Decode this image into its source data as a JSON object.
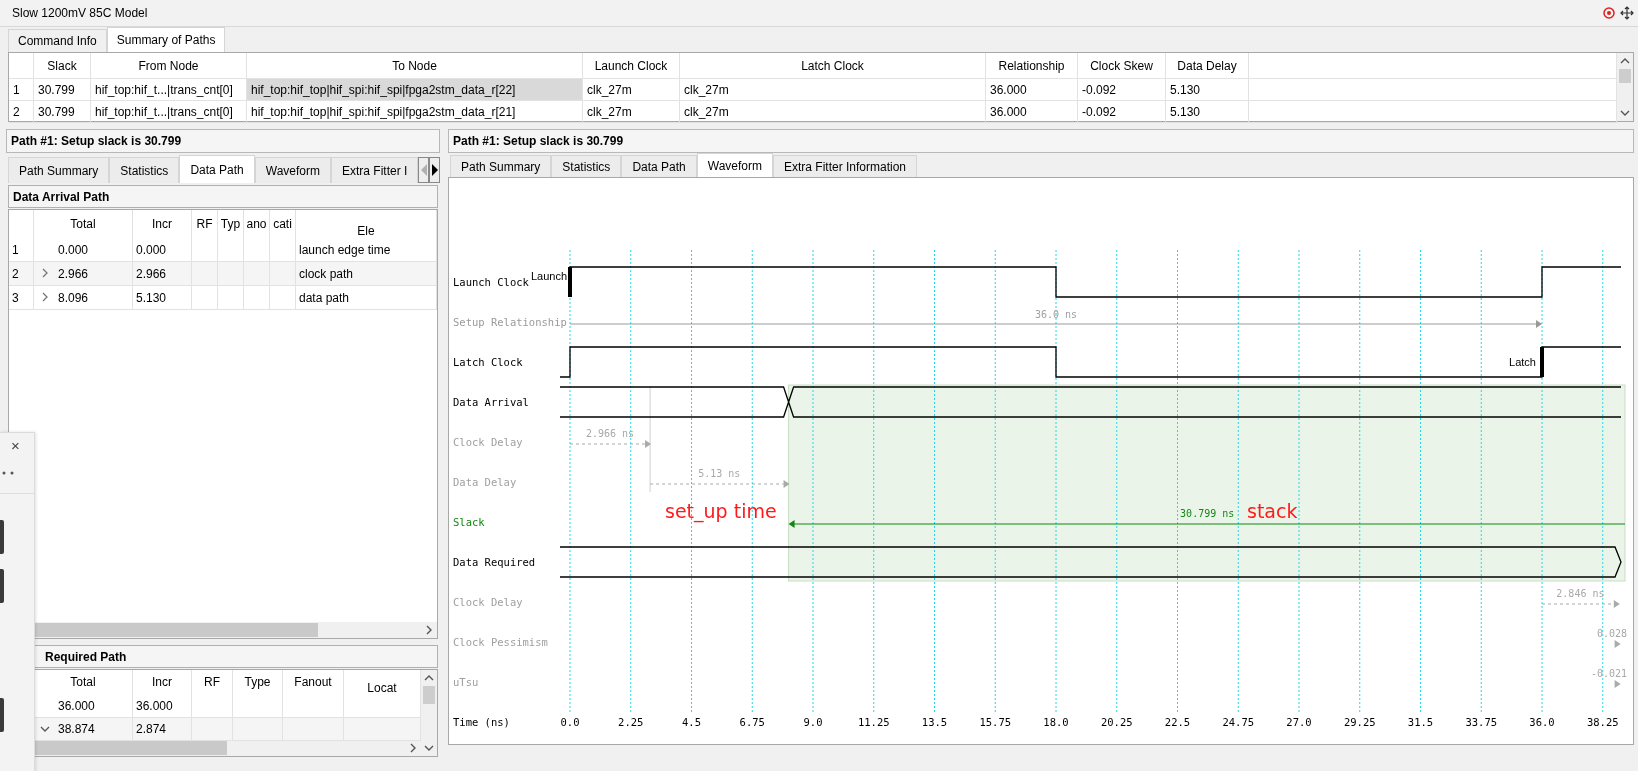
{
  "window": {
    "title": "Slow 1200mV 85C Model"
  },
  "tabs": [
    {
      "label": "Command Info",
      "selected": false
    },
    {
      "label": "Summary of Paths",
      "selected": true
    }
  ],
  "paths_table": {
    "columns": [
      "Slack",
      "From Node",
      "To Node",
      "Launch Clock",
      "Latch Clock",
      "Relationship",
      "Clock Skew",
      "Data Delay"
    ],
    "rows": [
      {
        "index": "1",
        "cells": [
          "30.799",
          "hif_top:hif_t...|trans_cnt[0]",
          "hif_top:hif_top|hif_spi:hif_spi|fpga2stm_data_r[22]",
          "clk_27m",
          "clk_27m",
          "36.000",
          "-0.092",
          "5.130"
        ],
        "selected": true
      },
      {
        "index": "2",
        "cells": [
          "30.799",
          "hif_top:hif_t...|trans_cnt[0]",
          "hif_top:hif_top|hif_spi:hif_spi|fpga2stm_data_r[21]",
          "clk_27m",
          "clk_27m",
          "36.000",
          "-0.092",
          "5.130"
        ],
        "selected": false
      }
    ]
  },
  "left_panel": {
    "title": "Path #1: Setup slack is 30.799",
    "tabs": [
      {
        "label": "Path Summary",
        "selected": false
      },
      {
        "label": "Statistics",
        "selected": false
      },
      {
        "label": "Data Path",
        "selected": true
      },
      {
        "label": "Waveform",
        "selected": false
      },
      {
        "label": "Extra Fitter I",
        "selected": false
      }
    ],
    "tab_scroll_buttons": [
      {
        "disabled": true
      },
      {
        "disabled": false
      }
    ],
    "arrival": {
      "title": "Data Arrival Path",
      "columns": [
        "Total",
        "Incr",
        "RF",
        "Typ",
        "ano",
        "cati",
        "Ele"
      ],
      "rows": [
        {
          "index": "1",
          "total": "0.000",
          "incr": "0.000",
          "element": "launch edge time"
        },
        {
          "index": "2",
          "total": "2.966",
          "incr": "2.966",
          "element": "clock path",
          "expanded": false
        },
        {
          "index": "3",
          "total": "8.096",
          "incr": "5.130",
          "element": "data path",
          "expanded": false
        }
      ]
    },
    "required": {
      "title": "Required Path",
      "columns": [
        "Total",
        "Incr",
        "RF",
        "Type",
        "Fanout",
        "Locat"
      ],
      "rows": [
        {
          "total": "36.000",
          "incr": "36.000"
        },
        {
          "total": "38.874",
          "incr": "2.874",
          "expanded": true
        }
      ]
    }
  },
  "waveform_panel": {
    "title": "Path #1: Setup slack is 30.799",
    "tabs": [
      {
        "label": "Path Summary",
        "selected": false
      },
      {
        "label": "Statistics",
        "selected": false
      },
      {
        "label": "Data Path",
        "selected": false
      },
      {
        "label": "Waveform",
        "selected": true
      },
      {
        "label": "Extra Fitter Information",
        "selected": false
      }
    ],
    "rows": [
      {
        "label": "Launch Clock",
        "kind": "launch",
        "marker": "Launch"
      },
      {
        "label": "Setup Relationship",
        "kind": "relationship",
        "value": "36.0 ns"
      },
      {
        "label": "Latch Clock",
        "kind": "latch",
        "marker": "Latch"
      },
      {
        "label": "Data Arrival",
        "kind": "arrival"
      },
      {
        "label": "Clock Delay",
        "kind": "delay",
        "value": "2.966 ns"
      },
      {
        "label": "Data Delay",
        "kind": "delay",
        "value": "5.13 ns"
      },
      {
        "label": "Slack",
        "kind": "slack",
        "value": "30.799 ns"
      },
      {
        "label": "Data Required",
        "kind": "required"
      },
      {
        "label": "Clock Delay",
        "kind": "delay",
        "value": "2.846 ns"
      },
      {
        "label": "Clock Pessimism",
        "kind": "delay",
        "value": "0.028"
      },
      {
        "label": "uTsu",
        "kind": "delay",
        "value": "-0.021"
      }
    ],
    "time_axis": {
      "label": "Time (ns)",
      "ticks": [
        "0.0",
        "2.25",
        "4.5",
        "6.75",
        "9.0",
        "11.25",
        "13.5",
        "15.75",
        "18.0",
        "20.25",
        "22.5",
        "24.75",
        "27.0",
        "29.25",
        "31.5",
        "33.75",
        "36.0",
        "38.25"
      ]
    },
    "annotations": [
      {
        "text": "set_up time"
      },
      {
        "text": "stack"
      }
    ]
  },
  "side_popup": {
    "close": "×"
  }
}
